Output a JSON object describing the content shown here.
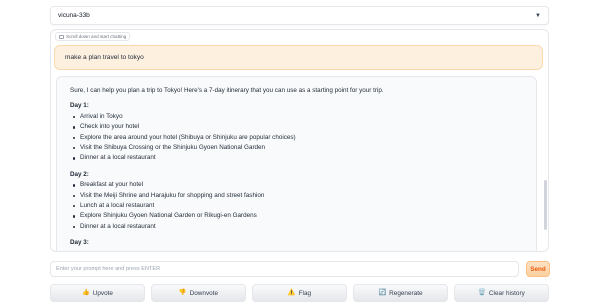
{
  "model_select": {
    "value": "vicuna-33b"
  },
  "chatbot": {
    "label": "Scroll down and start chatting",
    "user_message": "make a plan travel to tokyo",
    "assistant_intro": "Sure, I can help you plan a trip to Tokyo! Here's a 7-day itinerary that you can use as a starting point for your trip.",
    "days": [
      {
        "title": "Day 1:",
        "items": [
          "Arrival in Tokyo",
          "Check into your hotel",
          "Explore the area around your hotel (Shibuya or Shinjuku are popular choices)",
          "Visit the Shibuya Crossing or the Shinjuku Gyoen National Garden",
          "Dinner at a local restaurant"
        ]
      },
      {
        "title": "Day 2:",
        "items": [
          "Breakfast at your hotel",
          "Visit the Meiji Shrine and Harajuku for shopping and street fashion",
          "Lunch at a local restaurant",
          "Explore Shinjuku Gyoen National Garden or Rikugi-en Gardens",
          "Dinner at a local restaurant"
        ]
      },
      {
        "title": "Day 3:",
        "items": []
      }
    ]
  },
  "prompt": {
    "placeholder": "Enter your prompt here and press ENTER"
  },
  "send_label": "Send",
  "actions": {
    "upvote": {
      "icon": "👍",
      "label": "Upvote"
    },
    "downvote": {
      "icon": "👎",
      "label": "Downvote"
    },
    "flag": {
      "icon": "⚠️",
      "label": "Flag"
    },
    "regenerate": {
      "icon": "🔄",
      "label": "Regenerate"
    },
    "clear": {
      "icon": "🗑️",
      "label": "Clear history"
    }
  },
  "colors": {
    "user_bubble": "#fdf0df",
    "bot_bubble": "#f9fafb",
    "send_accent": "#ea580c"
  }
}
